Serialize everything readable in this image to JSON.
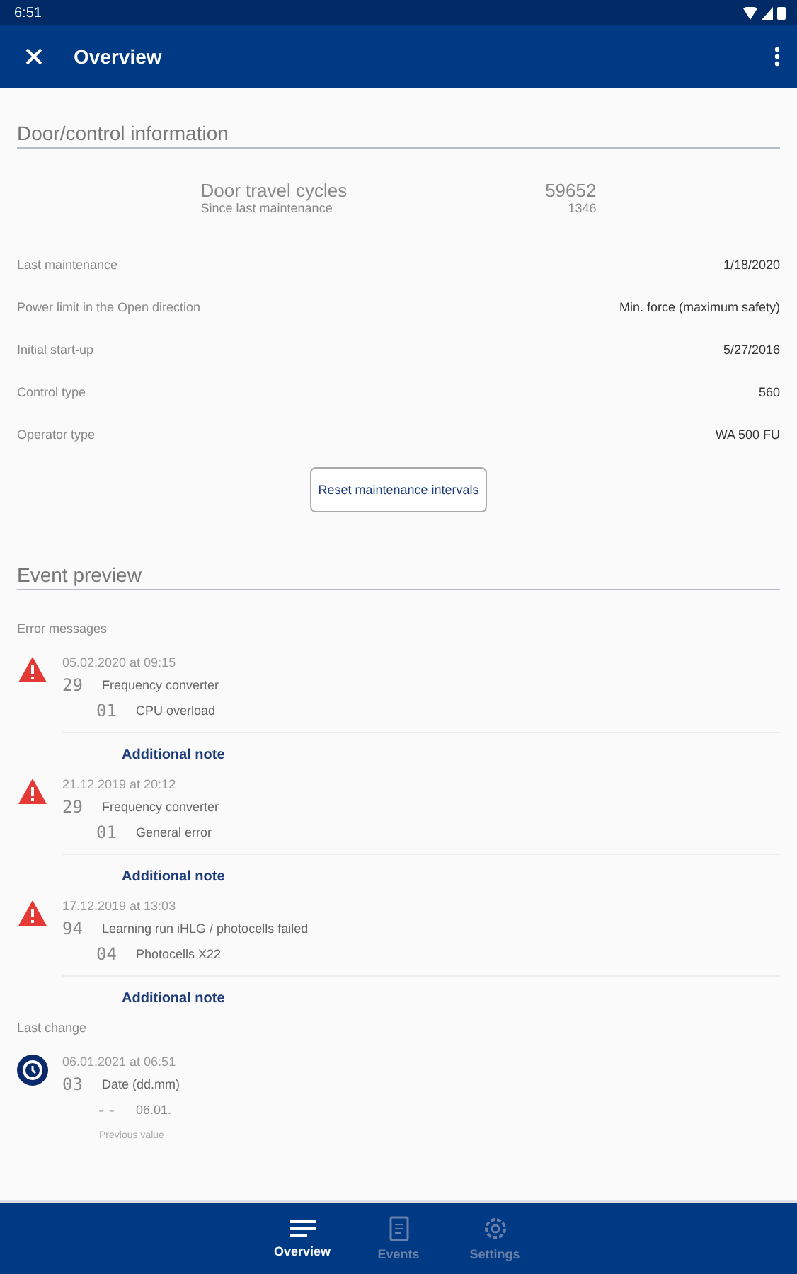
{
  "status_bar": {
    "time": "6:51"
  },
  "app_bar": {
    "title": "Overview"
  },
  "door_info": {
    "title": "Door/control information",
    "cycles": {
      "label": "Door travel cycles",
      "sublabel": "Since last maintenance",
      "value": "59652",
      "subvalue": "1346"
    },
    "rows": [
      {
        "label": "Last maintenance",
        "value": "1/18/2020"
      },
      {
        "label": "Power limit in the Open direction",
        "value": "Min. force (maximum safety)"
      },
      {
        "label": "Initial start-up",
        "value": "5/27/2016"
      },
      {
        "label": "Control type",
        "value": "560"
      },
      {
        "label": "Operator type",
        "value": "WA 500 FU"
      }
    ],
    "reset_button": "Reset maintenance intervals"
  },
  "event_preview": {
    "title": "Event preview",
    "errors_heading": "Error messages",
    "errors": [
      {
        "date": "05.02.2020 at 09:15",
        "code": "29",
        "text": "Frequency converter",
        "subcode": "01",
        "subtext": "CPU overload",
        "note_link": "Additional note"
      },
      {
        "date": "21.12.2019 at 20:12",
        "code": "29",
        "text": "Frequency converter",
        "subcode": "01",
        "subtext": "General error",
        "note_link": "Additional note"
      },
      {
        "date": "17.12.2019 at 13:03",
        "code": "94",
        "text": "Learning run iHLG / photocells failed",
        "subcode": "04",
        "subtext": "Photocells X22",
        "note_link": "Additional note"
      }
    ],
    "last_change_heading": "Last change",
    "last_change": {
      "date": "06.01.2021 at 06:51",
      "code": "03",
      "text": "Date (dd.mm)",
      "subcode": "--",
      "value": "06.01.",
      "previous_label": "Previous value"
    }
  },
  "bottom_nav": [
    {
      "label": "Overview",
      "kind": "lines",
      "selected": true
    },
    {
      "label": "Events",
      "kind": "document",
      "selected": false
    },
    {
      "label": "Settings",
      "kind": "gear",
      "selected": false
    }
  ]
}
